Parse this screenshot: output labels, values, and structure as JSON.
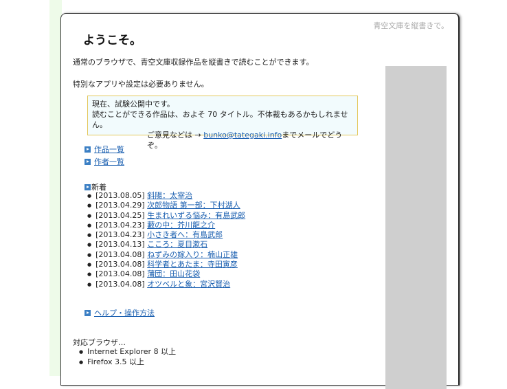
{
  "site_tag": "青空文庫を縦書きで。",
  "title": "ようこそ。",
  "intro1": "通常のブラウザで、青空文庫収録作品を縦書きで読むことができます。",
  "intro2": "特別なアプリや設定は必要ありません。",
  "notice": {
    "line1": "現在、試験公開中です。",
    "line2": "読むことができる作品は、およそ 70 タイトル。不体裁もあるかもしれません。",
    "contact_prefix": "ご意見などは → ",
    "contact_email": "bunko@tategaki.info",
    "contact_suffix": "までメールでどうぞ。"
  },
  "nav": {
    "works": "作品一覧",
    "authors": "作者一覧",
    "help": "ヘルプ・操作方法"
  },
  "news": {
    "heading": "新着",
    "items": [
      {
        "date": "[2013.08.05]",
        "title": "斜陽：太宰治"
      },
      {
        "date": "[2013.04.29]",
        "title": "次郎物語 第一部：下村湖人"
      },
      {
        "date": "[2013.04.25]",
        "title": "生まれいずる悩み：有島武郎"
      },
      {
        "date": "[2013.04.23]",
        "title": "藪の中：芥川龍之介"
      },
      {
        "date": "[2013.04.23]",
        "title": "小さき者へ：有島武郎"
      },
      {
        "date": "[2013.04.13]",
        "title": "こころ：夏目漱石"
      },
      {
        "date": "[2013.04.08]",
        "title": "ねずみの嫁入り：楠山正雄"
      },
      {
        "date": "[2013.04.08]",
        "title": "科学者とあたま：寺田寅彦"
      },
      {
        "date": "[2013.04.08]",
        "title": "蒲団：田山花袋"
      },
      {
        "date": "[2013.04.08]",
        "title": "オツベルと象：宮沢賢治"
      }
    ]
  },
  "browsers": {
    "label": "対応ブラウザ…",
    "items": [
      "Internet Explorer 8 以上",
      "Firefox 3.5 以上"
    ]
  }
}
